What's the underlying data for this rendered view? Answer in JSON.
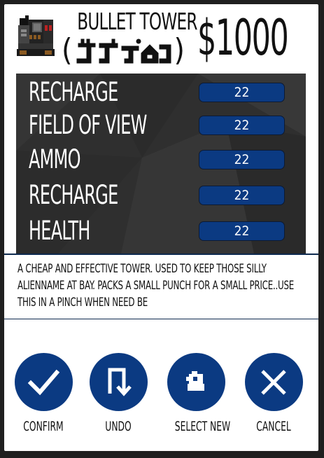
{
  "tower": {
    "name": "BULLET TOWER",
    "subtitle": "ジュウポルー",
    "price": "$1000",
    "icon": "robot-turret-icon"
  },
  "stats": [
    {
      "label": "RECHARGE",
      "value": "22"
    },
    {
      "label": "FIELD OF VIEW",
      "value": "22"
    },
    {
      "label": "AMMO",
      "value": "22"
    },
    {
      "label": "RECHARGE",
      "value": "22"
    },
    {
      "label": "HEALTH",
      "value": "22"
    }
  ],
  "description": "A CHEAP AND EFFECTIVE TOWER. USED TO KEEP THOSE SILLY ALIENNAME AT BAY. PACKS A SMALL PUNCH FOR A SMALL PRICE..USE THIS IN A PINCH WHEN NEED BE",
  "actions": [
    {
      "label": "CONFIRM",
      "icon": "check-icon"
    },
    {
      "label": "UNDO",
      "icon": "undo-arrow-icon"
    },
    {
      "label": "SELECT NEW",
      "icon": "tower-select-icon"
    },
    {
      "label": "CANCEL",
      "icon": "close-icon"
    }
  ],
  "colors": {
    "accent": "#0b3a82",
    "panel": "#2f2f2f",
    "background": "#1f1f1f",
    "card": "#ffffff"
  }
}
